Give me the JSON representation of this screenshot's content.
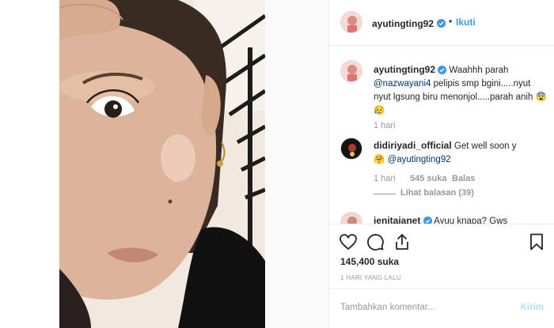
{
  "header": {
    "username": "ayutingting92",
    "dot": "•",
    "follow_label": "Ikuti"
  },
  "caption": {
    "username": "ayutingting92",
    "text_start": "Waahhh parah",
    "mention": "@nazwayani4",
    "text_end": "pelipis smp bgini.....nyut nyut lgsung biru menonjol.....parah anih",
    "emoji": "😨😥",
    "time": "1 hari"
  },
  "comments": [
    {
      "username": "didiriyadi_official",
      "text_start": "Get well soon y",
      "emoji": "🤗",
      "mention": "@ayutingting92",
      "time": "1 hari",
      "likes": "545 suka",
      "reply_label": "Balas",
      "view_replies": "Lihat balasan (39)"
    },
    {
      "username": "jenitajanet",
      "text_start": "Ayuu knapa? Gws"
    }
  ],
  "actions": {
    "likes": "145,400 suka",
    "time_ago": "1 HARI YANG LALU"
  },
  "add_comment": {
    "placeholder": "Tambahkan komentar...",
    "post_label": "Kirim"
  },
  "colors": {
    "link_blue": "#3897f0",
    "verified_blue": "#3897f0",
    "mention": "#003569",
    "muted": "#999999"
  },
  "icons": [
    "verified-badge-icon",
    "heart-icon",
    "comment-icon",
    "share-icon",
    "bookmark-icon"
  ]
}
